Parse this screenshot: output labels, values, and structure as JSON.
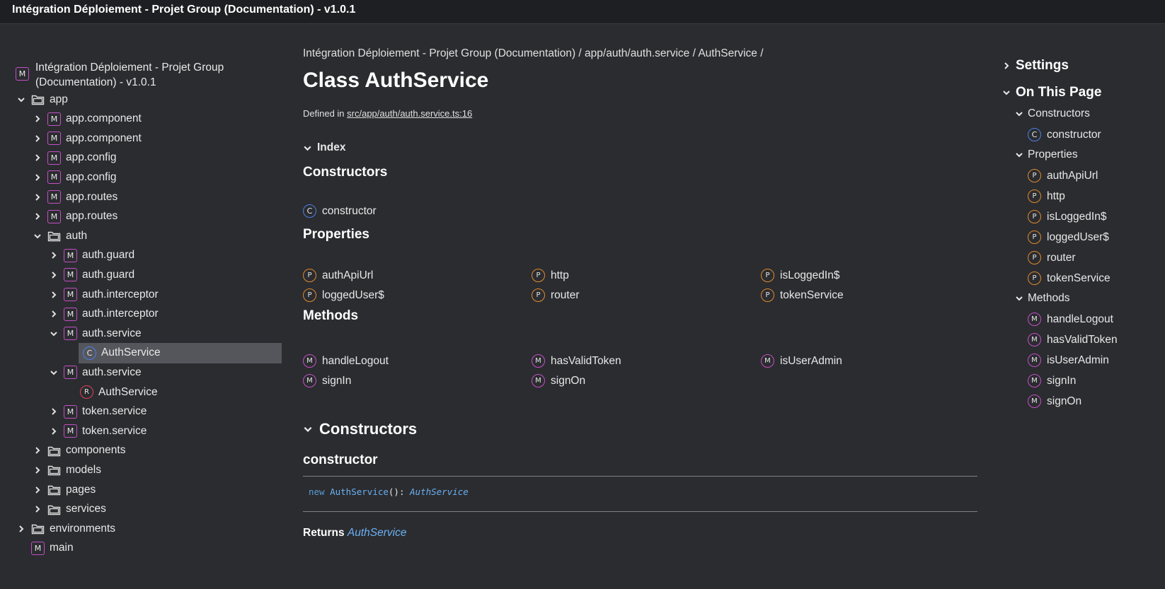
{
  "window": {
    "title": "Intégration Déploiement - Projet Group (Documentation) - v1.0.1"
  },
  "nav": {
    "root_label": "Intégration Déploiement - Projet Group (Documentation) - v1.0.1",
    "items": [
      {
        "label": "app",
        "kind": "folder",
        "expanded": true
      },
      {
        "label": "app.component",
        "kind": "module",
        "expanded": false
      },
      {
        "label": "app.component",
        "kind": "module",
        "expanded": false
      },
      {
        "label": "app.config",
        "kind": "module",
        "expanded": false
      },
      {
        "label": "app.config",
        "kind": "module",
        "expanded": false
      },
      {
        "label": "app.routes",
        "kind": "module",
        "expanded": false
      },
      {
        "label": "app.routes",
        "kind": "module",
        "expanded": false
      },
      {
        "label": "auth",
        "kind": "folder",
        "expanded": true
      },
      {
        "label": "auth.guard",
        "kind": "module",
        "expanded": false
      },
      {
        "label": "auth.guard",
        "kind": "module",
        "expanded": false
      },
      {
        "label": "auth.interceptor",
        "kind": "module",
        "expanded": false
      },
      {
        "label": "auth.interceptor",
        "kind": "module",
        "expanded": false
      },
      {
        "label": "auth.service",
        "kind": "module",
        "expanded": true
      },
      {
        "label": "AuthService",
        "kind": "class",
        "selected": true
      },
      {
        "label": "auth.service",
        "kind": "module",
        "expanded": true
      },
      {
        "label": "AuthService",
        "kind": "reference"
      },
      {
        "label": "token.service",
        "kind": "module",
        "expanded": false
      },
      {
        "label": "token.service",
        "kind": "module",
        "expanded": false
      },
      {
        "label": "components",
        "kind": "folder",
        "expanded": false
      },
      {
        "label": "models",
        "kind": "folder",
        "expanded": false
      },
      {
        "label": "pages",
        "kind": "folder",
        "expanded": false
      },
      {
        "label": "services",
        "kind": "folder",
        "expanded": false
      },
      {
        "label": "environments",
        "kind": "folder",
        "expanded": false
      },
      {
        "label": "main",
        "kind": "module"
      }
    ]
  },
  "main": {
    "breadcrumb": {
      "part1": "Intégration Déploiement - Projet Group (Documentation)",
      "sep": "/",
      "part2": "app/auth/auth.service",
      "part3": "AuthService"
    },
    "title": "Class AuthService",
    "defined_prefix": "Defined in ",
    "defined_link": "src/app/auth/auth.service.ts:16",
    "index_label": "Index",
    "constructors_heading": "Constructors",
    "constructors": [
      "constructor"
    ],
    "properties_heading": "Properties",
    "properties": [
      "authApiUrl",
      "http",
      "isLoggedIn$",
      "loggedUser$",
      "router",
      "tokenService"
    ],
    "methods_heading": "Methods",
    "methods": [
      "handleLogout",
      "hasValidToken",
      "isUserAdmin",
      "signIn",
      "signOn"
    ],
    "constructors_section": "Constructors",
    "constructor_name": "constructor",
    "signature": {
      "kw": "new",
      "name": "AuthService",
      "parens": "(): ",
      "type": "AuthService"
    },
    "returns_label": "Returns",
    "returns_type": "AuthService"
  },
  "side": {
    "settings": "Settings",
    "on_this_page": "On This Page",
    "groups": [
      {
        "label": "Constructors",
        "kind": "constructor",
        "items": [
          "constructor"
        ]
      },
      {
        "label": "Properties",
        "kind": "property",
        "items": [
          "authApiUrl",
          "http",
          "isLoggedIn$",
          "loggedUser$",
          "router",
          "tokenService"
        ]
      },
      {
        "label": "Methods",
        "kind": "method",
        "items": [
          "handleLogout",
          "hasValidToken",
          "isUserAdmin",
          "signIn",
          "signOn"
        ]
      }
    ]
  },
  "icon_letters": {
    "module": "M",
    "class": "C",
    "property": "P",
    "method": "M",
    "reference": "R"
  },
  "colors": {
    "background": "#2b2c30",
    "selected": "#55565c",
    "module": "#c44fc4",
    "class": "#4b7fe6",
    "property": "#e08a2e",
    "reference": "#e0405b",
    "link_type": "#6ab0f3"
  }
}
